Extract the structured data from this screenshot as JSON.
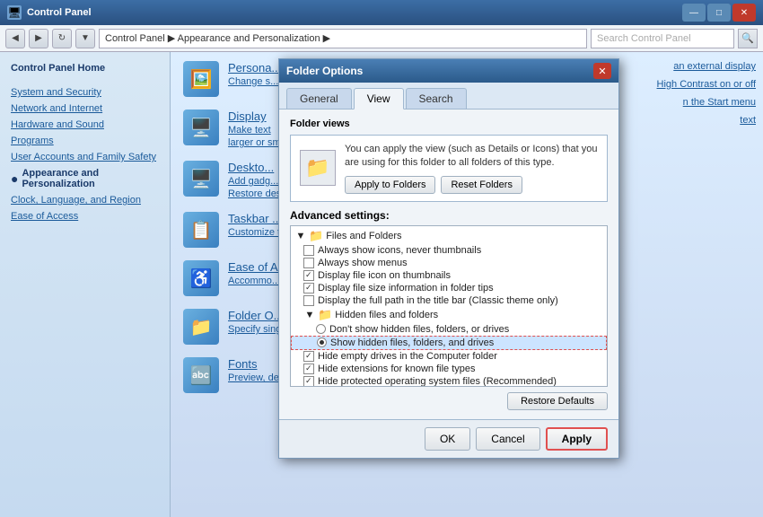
{
  "window": {
    "title": "Appearance and Personalization",
    "title_bar_text": "Control Panel",
    "min_btn": "—",
    "max_btn": "□",
    "close_btn": "✕"
  },
  "address_bar": {
    "path": "Control Panel  ▶  Appearance and Personalization  ▶",
    "search_placeholder": "Search Control Panel",
    "search_icon": "🔍",
    "back_arrow": "◀",
    "forward_arrow": "▶",
    "dropdown_arrow": "▼",
    "refresh": "↻"
  },
  "sidebar": {
    "home_label": "Control Panel Home",
    "items": [
      {
        "id": "system-security",
        "label": "System and Security"
      },
      {
        "id": "network-internet",
        "label": "Network and Internet"
      },
      {
        "id": "hardware-sound",
        "label": "Hardware and Sound"
      },
      {
        "id": "programs",
        "label": "Programs"
      },
      {
        "id": "user-accounts",
        "label": "User Accounts and Family Safety"
      },
      {
        "id": "appearance",
        "label": "Appearance and Personalization",
        "active": true
      },
      {
        "id": "clock-language",
        "label": "Clock, Language, and Region"
      },
      {
        "id": "ease",
        "label": "Ease of Access"
      }
    ]
  },
  "content": {
    "items": [
      {
        "id": "personalization",
        "title": "Persona...",
        "sub1": "Change s...",
        "sub2": "",
        "icon": "🖼️"
      },
      {
        "id": "display",
        "title": "Display",
        "sub1": "Make text",
        "sub2": "larger or smaller",
        "icon": "🖥️",
        "right_link": "an external display"
      },
      {
        "id": "desktop",
        "title": "Deskto...",
        "sub1": "Add gadg...",
        "sub2": "Restore des...",
        "icon": "🖥️",
        "right_link": "High Contrast on or off"
      },
      {
        "id": "taskbar",
        "title": "Taskbar ...",
        "sub1": "Customize t...",
        "icon": "📋",
        "right_link": "n the Start menu"
      },
      {
        "id": "ease-of-access",
        "title": "Ease of A...",
        "sub1": "Accommo...",
        "icon": "♿",
        "right_link": "text"
      },
      {
        "id": "folder-options",
        "title": "Folder O...",
        "sub1": "Specify sing...",
        "icon": "📁"
      },
      {
        "id": "fonts",
        "title": "Fonts",
        "sub1": "Preview, de...",
        "icon": "🔤"
      }
    ]
  },
  "dialog": {
    "title": "Folder Options",
    "close_btn": "✕",
    "tabs": [
      {
        "id": "general",
        "label": "General"
      },
      {
        "id": "view",
        "label": "View",
        "active": true
      },
      {
        "id": "search",
        "label": "Search"
      }
    ],
    "folder_views": {
      "label": "Folder views",
      "description": "You can apply the view (such as Details or Icons) that you are using for this folder to all folders of this type.",
      "apply_btn": "Apply to Folders",
      "reset_btn": "Reset Folders"
    },
    "advanced_settings": {
      "label": "Advanced settings:",
      "items": [
        {
          "type": "folder-header",
          "label": "Files and Folders",
          "indent": 0
        },
        {
          "type": "checkbox",
          "checked": false,
          "label": "Always show icons, never thumbnails",
          "indent": 1
        },
        {
          "type": "checkbox",
          "checked": false,
          "label": "Always show menus",
          "indent": 1
        },
        {
          "type": "checkbox",
          "checked": true,
          "label": "Display file icon on thumbnails",
          "indent": 1
        },
        {
          "type": "checkbox",
          "checked": true,
          "label": "Display file size information in folder tips",
          "indent": 1
        },
        {
          "type": "checkbox",
          "checked": false,
          "label": "Display the full path in the title bar (Classic theme only)",
          "indent": 1
        },
        {
          "type": "folder-header",
          "label": "Hidden files and folders",
          "indent": 1
        },
        {
          "type": "radio",
          "selected": false,
          "label": "Don't show hidden files, folders, or drives",
          "indent": 2
        },
        {
          "type": "radio",
          "selected": true,
          "label": "Show hidden files, folders, and drives",
          "indent": 2,
          "highlighted": true
        },
        {
          "type": "checkbox",
          "checked": true,
          "label": "Hide empty drives in the Computer folder",
          "indent": 1
        },
        {
          "type": "checkbox",
          "checked": true,
          "label": "Hide extensions for known file types",
          "indent": 1
        },
        {
          "type": "checkbox",
          "checked": true,
          "label": "Hide protected operating system files (Recommended)",
          "indent": 1
        }
      ]
    },
    "restore_defaults_btn": "Restore Defaults",
    "footer": {
      "ok_btn": "OK",
      "cancel_btn": "Cancel",
      "apply_btn": "Apply"
    }
  }
}
